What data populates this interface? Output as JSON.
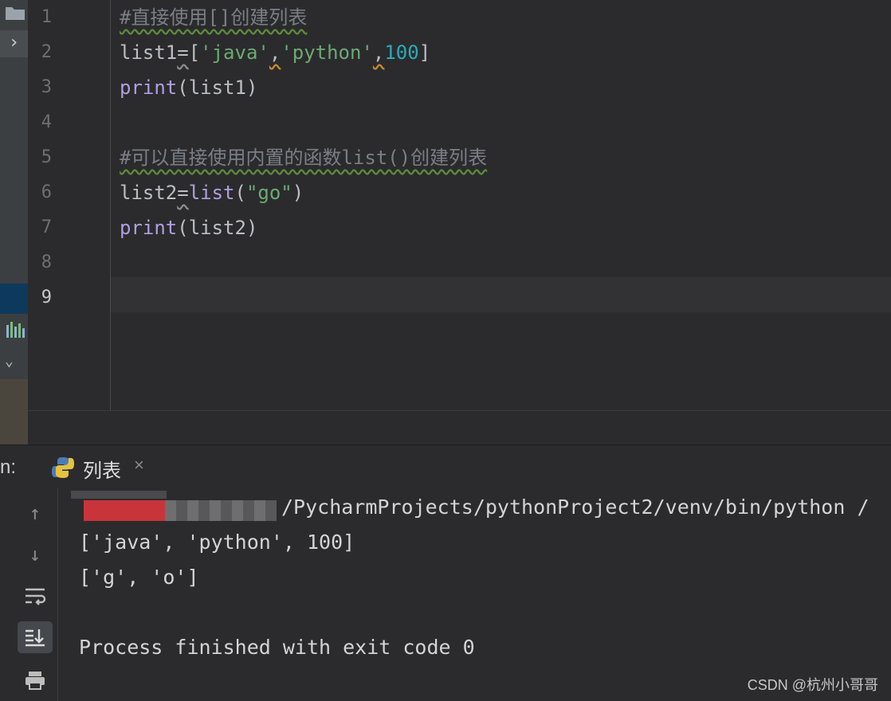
{
  "editor": {
    "line_numbers": [
      "1",
      "2",
      "3",
      "4",
      "5",
      "6",
      "7",
      "8",
      "9"
    ],
    "active_line": "9",
    "lines": {
      "l1_comment": "#直接使用[]创建列表",
      "l2_var": "list1",
      "l2_eq": "=",
      "l2_lbr": "[",
      "l2_s1": "'java'",
      "l2_c1": ",",
      "l2_s2": "'python'",
      "l2_c2": ",",
      "l2_num": "100",
      "l2_rbr": "]",
      "l3_fn": "print",
      "l3_args": "(list1)",
      "l5_comment": "#可以直接使用内置的函数list()创建列表",
      "l6_var": "list2",
      "l6_eq": "=",
      "l6_fn": "list",
      "l6_lp": "(",
      "l6_str": "\"go\"",
      "l6_rp": ")",
      "l7_fn": "print",
      "l7_args": "(list2)"
    }
  },
  "run_panel": {
    "label": "n:",
    "tab_title": "列表",
    "tab_close": "×",
    "output": {
      "path_line": "/PycharmProjects/pythonProject2/venv/bin/python /",
      "out1": "['java', 'python', 100]",
      "out2": "['g', 'o']",
      "finish": "Process finished with exit code 0"
    }
  },
  "watermark": "CSDN @杭州小哥哥",
  "icons": {
    "folder": "folder-icon",
    "expand": "chevron-right-icon",
    "bars": "bar-chart-icon",
    "collapse": "chevron-down-icon",
    "python": "python-icon",
    "up": "arrow-up-icon",
    "down": "arrow-down-icon",
    "wrap": "soft-wrap-icon",
    "scroll": "scroll-to-end-icon",
    "print": "print-icon"
  },
  "colors": {
    "background": "#2b2b2d",
    "comment": "#7a7e85",
    "function": "#b09fe0",
    "string": "#6aab73",
    "number": "#2aacb8"
  }
}
